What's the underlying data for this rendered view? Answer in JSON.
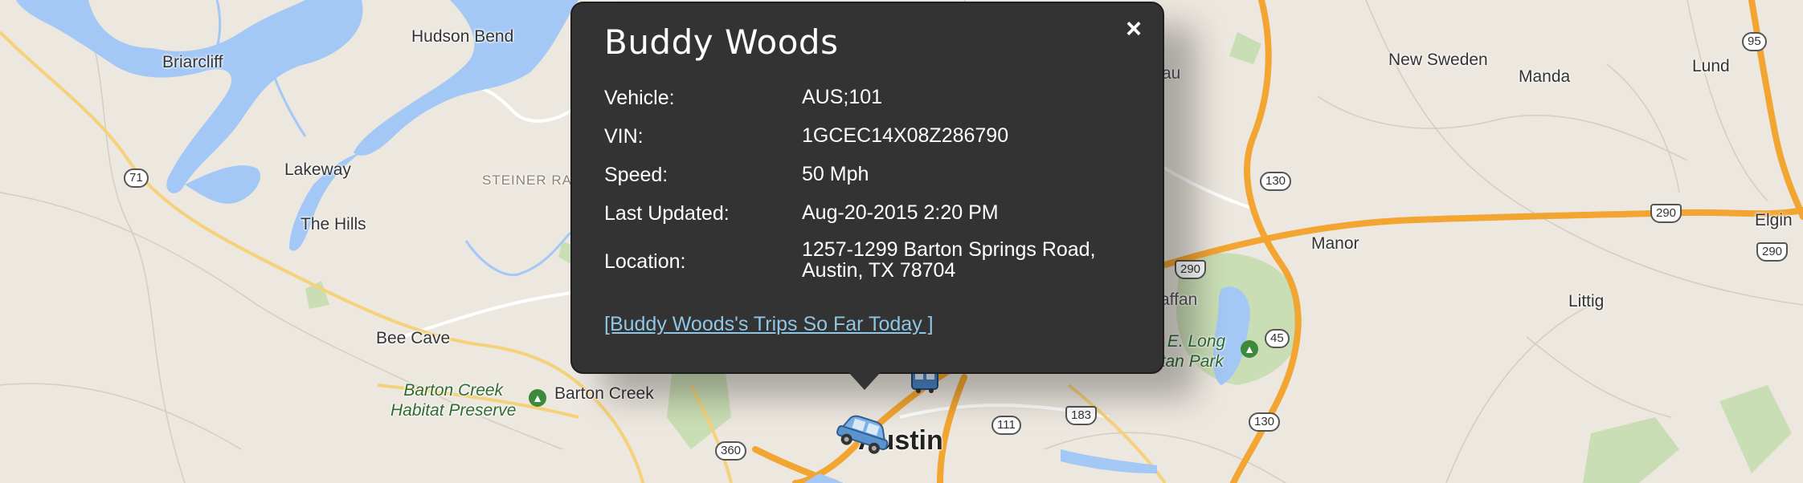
{
  "map": {
    "places": [
      {
        "id": "briarcliff",
        "label": "Briarcliff"
      },
      {
        "id": "hudson-bend",
        "label": "Hudson Bend"
      },
      {
        "id": "lakeway",
        "label": "Lakeway"
      },
      {
        "id": "the-hills",
        "label": "The Hills"
      },
      {
        "id": "bee-cave",
        "label": "Bee Cave"
      },
      {
        "id": "barton-creek",
        "label": "Barton Creek"
      },
      {
        "id": "new-sweden",
        "label": "New Sweden"
      },
      {
        "id": "manda",
        "label": "Manda"
      },
      {
        "id": "lund",
        "label": "Lund"
      },
      {
        "id": "manor",
        "label": "Manor"
      },
      {
        "id": "elgin",
        "label": "Elgin"
      },
      {
        "id": "littig",
        "label": "Littig"
      },
      {
        "id": "austin",
        "label": "Austin"
      },
      {
        "id": "steiner-ranch",
        "label": "STEINER RAN"
      },
      {
        "id": "au-partial",
        "label": "au"
      },
      {
        "id": "pflugerville-partial",
        "label": "affan"
      }
    ],
    "parks": [
      {
        "id": "barton-creek-habitat",
        "line1": "Barton Creek",
        "line2": "Habitat Preserve"
      },
      {
        "id": "walter-e-long",
        "line1": "r E. Long",
        "line2": "itan Park"
      }
    ],
    "shields": [
      "71",
      "95",
      "130",
      "290",
      "290",
      "290",
      "45",
      "130",
      "111",
      "183",
      "360"
    ],
    "vehicles": [
      "car-icon",
      "bus-icon"
    ]
  },
  "popup": {
    "title": "Buddy Woods",
    "close_icon": "×",
    "rows": [
      {
        "label": "Vehicle:",
        "value": "AUS;101"
      },
      {
        "label": "VIN:",
        "value": "1GCEC14X08Z286790"
      },
      {
        "label": "Speed:",
        "value": "50 Mph"
      },
      {
        "label": "Last Updated:",
        "value": "Aug-20-2015 2:20 PM"
      },
      {
        "label": "Location:",
        "value": "1257-1299 Barton Springs Road, Austin, TX 78704"
      }
    ],
    "trips_link": "[Buddy Woods's Trips So Far Today ]"
  },
  "colors": {
    "popup_bg": "#333333",
    "link": "#8fc6e6",
    "water": "#a4c8f5",
    "highway": "#f3a532",
    "park": "#bfdba6"
  }
}
